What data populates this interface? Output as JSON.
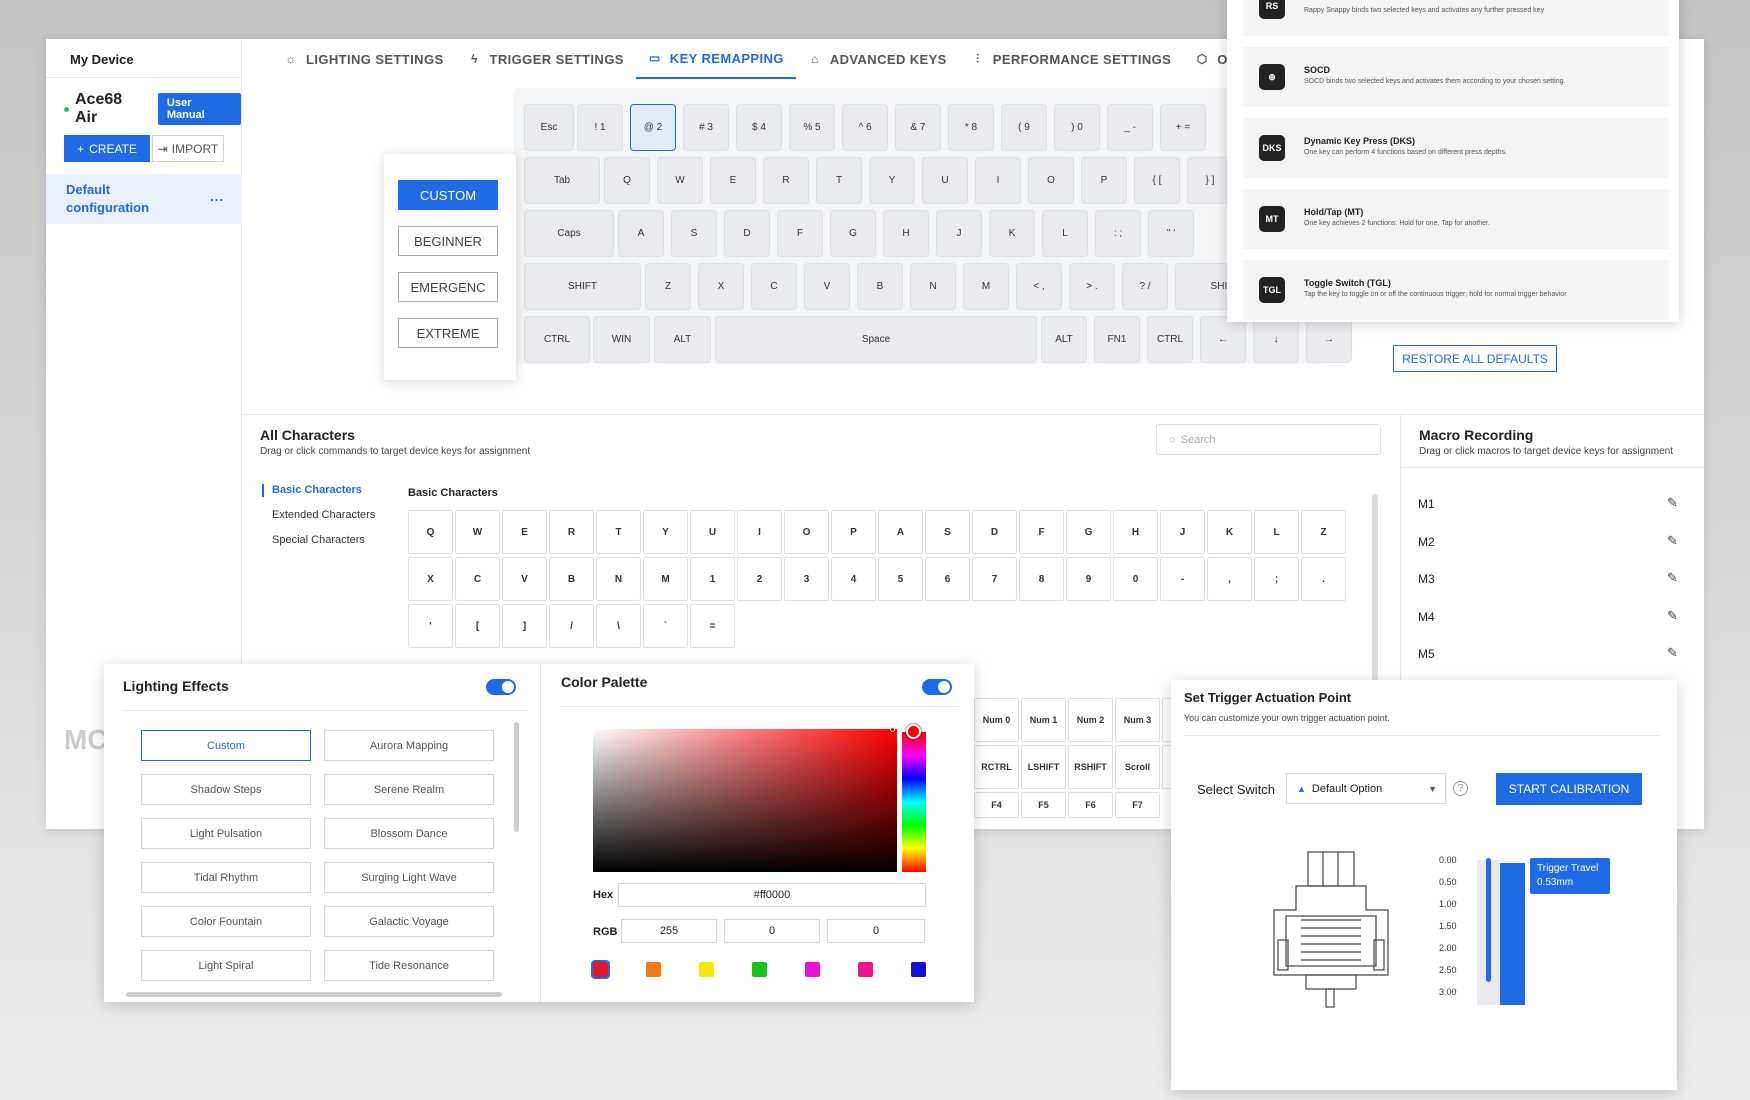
{
  "sidebar": {
    "title": "My Device",
    "device_name": "Ace68 Air",
    "manual": "User Manual",
    "create": "CREATE",
    "import": "IMPORT",
    "config": "Default configuration",
    "more": "...",
    "logo_partial": "MC"
  },
  "nav": [
    {
      "label": "LIGHTING SETTINGS",
      "icon": "bulb-icon"
    },
    {
      "label": "TRIGGER SETTINGS",
      "icon": "lightning-icon"
    },
    {
      "label": "KEY REMAPPING",
      "icon": "keyboard-icon"
    },
    {
      "label": "ADVANCED KEYS",
      "icon": "key-icon"
    },
    {
      "label": "PERFORMANCE SETTINGS",
      "icon": "sliders-icon"
    },
    {
      "label": "OTHER S",
      "icon": "gear-icon"
    }
  ],
  "presets": [
    "CUSTOM",
    "BEGINNER",
    "EMERGENC",
    "EXTREME"
  ],
  "keyboard": {
    "row1": [
      "Esc",
      "! 1",
      "@ 2",
      "# 3",
      "$ 4",
      "% 5",
      "^ 6",
      "& 7",
      "* 8",
      "( 9",
      ") 0",
      "_ -",
      "+ ="
    ],
    "row2": [
      "Tab",
      "Q",
      "W",
      "E",
      "R",
      "T",
      "Y",
      "U",
      "I",
      "O",
      "P",
      "{ [",
      "} ]"
    ],
    "row3": [
      "Caps",
      "A",
      "S",
      "D",
      "F",
      "G",
      "H",
      "J",
      "K",
      "L",
      ": ;",
      "\" '"
    ],
    "row4": [
      "SHIFT",
      "Z",
      "X",
      "C",
      "V",
      "B",
      "N",
      "M",
      "< ,",
      "> .",
      "? /",
      "SHIFT"
    ],
    "row5": [
      "CTRL",
      "WIN",
      "ALT",
      "Space",
      "ALT",
      "FN1",
      "CTRL",
      "←",
      "↓",
      "→"
    ]
  },
  "restore": "RESTORE ALL DEFAULTS",
  "advanced": [
    {
      "title": "",
      "desc": "Rappy Snappy binds two selected keys and activates any further pressed key",
      "icon": "RS"
    },
    {
      "title": "SOCD",
      "desc": "SOCD binds two selected keys and activates them according to your chosen setting.",
      "icon": "SOCD"
    },
    {
      "title": "Dynamic Key Press (DKS)",
      "desc": "One key can perform 4 functions based on different press depths.",
      "icon": "DKS"
    },
    {
      "title": "Hold/Tap (MT)",
      "desc": "One key achieves 2 functions: Hold for one, Tap for another.",
      "icon": "MT"
    },
    {
      "title": "Toggle Switch (TGL)",
      "desc": "Tap the key to toggle on or off the continuous trigger; hold for normal trigger behavior",
      "icon": "TGL"
    }
  ],
  "chars": {
    "title": "All Characters",
    "sub": "Drag or click commands to target device keys for assignment",
    "search": "Search",
    "categories": [
      "Basic Characters",
      "Extended Characters",
      "Special Characters"
    ],
    "section": "Basic Characters",
    "row1": [
      "Q",
      "W",
      "E",
      "R",
      "T",
      "Y",
      "U",
      "I",
      "O",
      "P",
      "A",
      "S",
      "D",
      "F",
      "G",
      "H",
      "J",
      "K",
      "L",
      "Z"
    ],
    "row2": [
      "X",
      "C",
      "V",
      "B",
      "N",
      "M",
      "1",
      "2",
      "3",
      "4",
      "5",
      "6",
      "7",
      "8",
      "9",
      "0",
      "-",
      ",",
      ";",
      "."
    ],
    "row3": [
      "'",
      "[",
      "]",
      "/",
      "\\",
      "`",
      "="
    ],
    "extra": [
      "Num 0",
      "Num 1",
      "Num 2",
      "Num 3",
      "N",
      "RCTRL",
      "LSHIFT",
      "RSHIFT",
      "Scroll",
      "S",
      "F4",
      "F5",
      "F6",
      "F7"
    ]
  },
  "macro": {
    "title": "Macro Recording",
    "sub": "Drag or click macros to target device keys for assignment",
    "items": [
      "M1",
      "M2",
      "M3",
      "M4",
      "M5"
    ]
  },
  "lighting": {
    "title": "Lighting Effects",
    "effects": [
      "Custom",
      "Aurora Mapping",
      "Shadow Steps",
      "Serene Realm",
      "Light Pulsation",
      "Blossom Dance",
      "Tidal Rhythm",
      "Surging Light Wave",
      "Color Fountain",
      "Galactic Voyage",
      "Light Spiral",
      "Tide Resonance"
    ]
  },
  "palette": {
    "title": "Color Palette",
    "hex_label": "Hex",
    "hex": "#ff0000",
    "rgb_label": "RGB",
    "r": "255",
    "g": "0",
    "b": "0",
    "swatches": [
      "#e0182d",
      "#f47a16",
      "#f5e60c",
      "#19c21b",
      "#e812d9",
      "#f0148c",
      "#1212d6"
    ]
  },
  "trigger": {
    "title": "Set Trigger Actuation Point",
    "sub": "You can customize your own trigger actuation point.",
    "select_label": "Select Switch",
    "option": "Default Option",
    "calibrate": "START CALIBRATION",
    "ticks": [
      "0.00",
      "0.50",
      "1.00",
      "1.50",
      "2.00",
      "2.50",
      "3.00"
    ],
    "tip_title": "Trigger Travel",
    "tip_value": "0.53mm",
    "travel_mm": 0.53
  }
}
